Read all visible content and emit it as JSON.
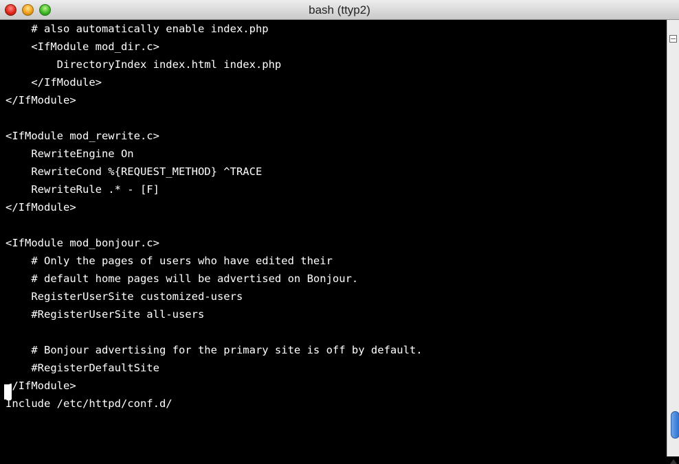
{
  "window": {
    "title": "bash (ttyp2)"
  },
  "terminal": {
    "lines": [
      "    # also automatically enable index.php",
      "    <IfModule mod_dir.c>",
      "        DirectoryIndex index.html index.php",
      "    </IfModule>",
      "</IfModule>",
      "",
      "<IfModule mod_rewrite.c>",
      "    RewriteEngine On",
      "    RewriteCond %{REQUEST_METHOD} ^TRACE",
      "    RewriteRule .* - [F]",
      "</IfModule>",
      "",
      "<IfModule mod_bonjour.c>",
      "    # Only the pages of users who have edited their",
      "    # default home pages will be advertised on Bonjour.",
      "    RegisterUserSite customized-users",
      "    #RegisterUserSite all-users",
      "",
      "    # Bonjour advertising for the primary site is off by default.",
      "    #RegisterDefaultSite",
      "</IfModule>",
      "Include /etc/httpd/conf.d/"
    ]
  },
  "colors": {
    "terminal_bg": "#000000",
    "terminal_fg": "#ffffff",
    "close": "#e0281e",
    "minimize": "#f0a020",
    "zoom": "#3fb828"
  },
  "icons": {
    "close": "close-icon",
    "minimize": "minimize-icon",
    "zoom": "zoom-icon",
    "split": "split-pane-icon"
  }
}
